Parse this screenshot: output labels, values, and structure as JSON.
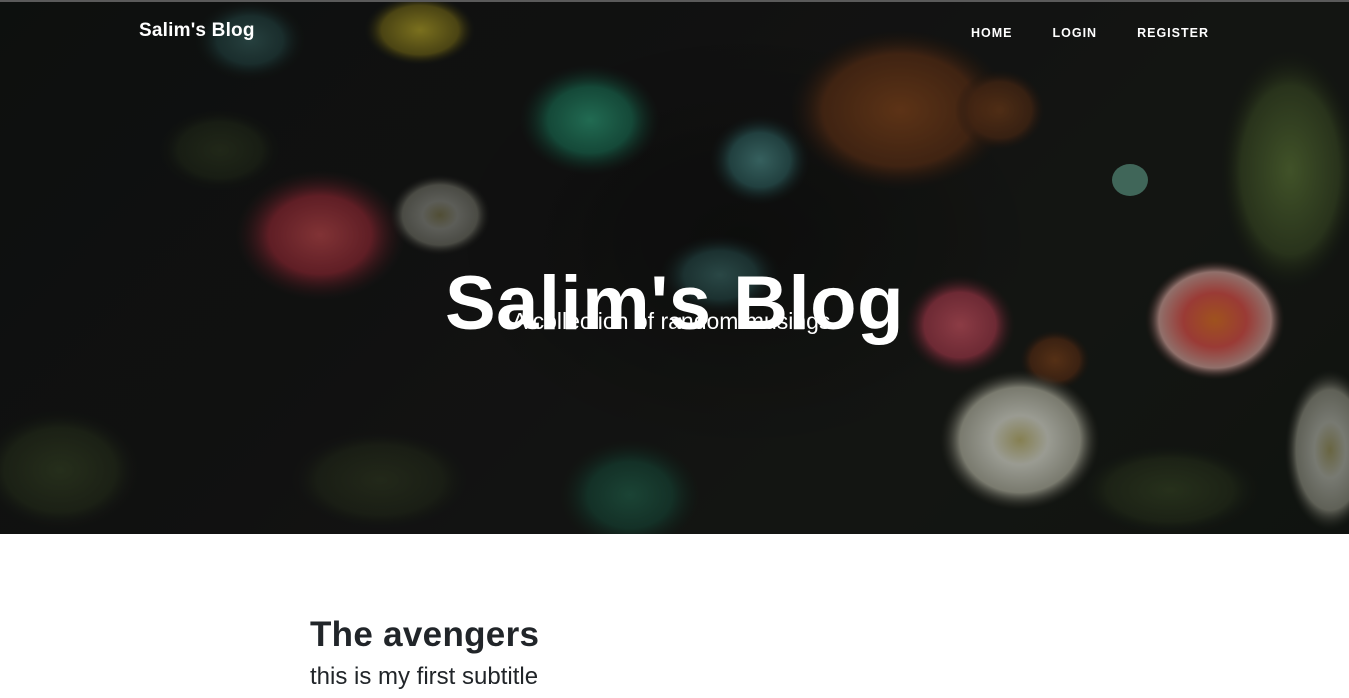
{
  "navbar": {
    "brand": "Salim's Blog",
    "links": [
      "HOME",
      "LOGIN",
      "REGISTER"
    ]
  },
  "hero": {
    "title": "Salim's Blog",
    "subtitle": "A collection of random musings."
  },
  "posts": [
    {
      "title": "The avengers",
      "subtitle": "this is my first subtitle"
    }
  ]
}
